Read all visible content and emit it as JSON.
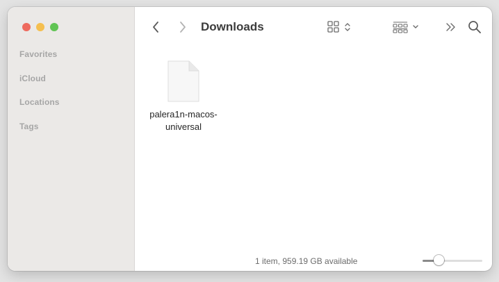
{
  "window": {
    "title": "Downloads"
  },
  "sidebar": {
    "sections": [
      {
        "label": "Favorites"
      },
      {
        "label": "iCloud"
      },
      {
        "label": "Locations"
      },
      {
        "label": "Tags"
      }
    ]
  },
  "toolbar": {
    "icons": {
      "back": "chevron-left-icon",
      "forward": "chevron-right-icon",
      "view": "grid-view-icon",
      "group": "group-by-icon",
      "more": "more-toolbar-items-icon",
      "search": "search-icon"
    }
  },
  "files": [
    {
      "name": "palera1n-macos-universal",
      "icon": "document-icon"
    }
  ],
  "status_bar": {
    "text": "1 item, 959.19 GB available",
    "icon_size": 0.2
  },
  "colors": {
    "sidebar_bg": "#ebe9e7",
    "close": "#ee6a5e",
    "minimize": "#f5bf4f",
    "zoom": "#61c454"
  }
}
